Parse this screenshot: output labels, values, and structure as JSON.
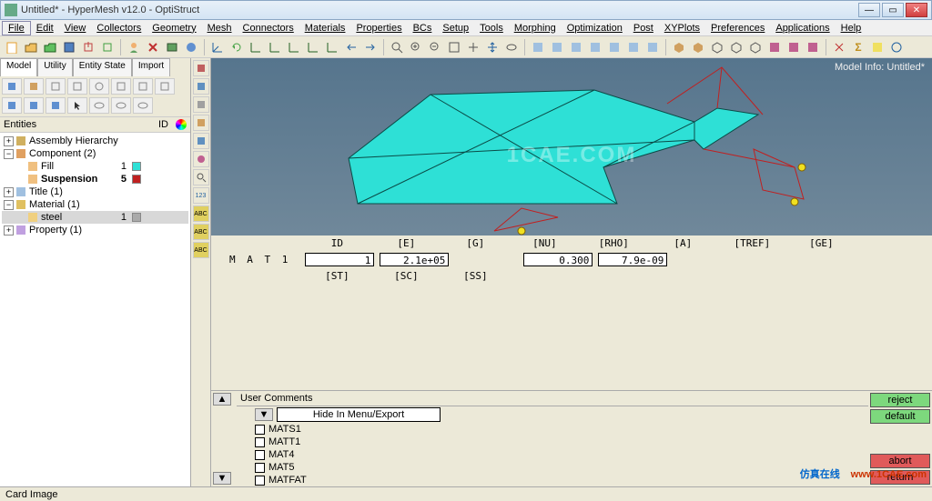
{
  "window": {
    "title": "Untitled* - HyperMesh v12.0 - OptiStruct"
  },
  "menu": [
    "File",
    "Edit",
    "View",
    "Collectors",
    "Geometry",
    "Mesh",
    "Connectors",
    "Materials",
    "Properties",
    "BCs",
    "Setup",
    "Tools",
    "Morphing",
    "Optimization",
    "Post",
    "XYPlots",
    "Preferences",
    "Applications",
    "Help"
  ],
  "tabs": [
    "Model",
    "Utility",
    "Entity State",
    "Import"
  ],
  "tree": {
    "headers": {
      "entities": "Entities",
      "id": "ID"
    },
    "assembly": "Assembly Hierarchy",
    "component": {
      "label": "Component (2)"
    },
    "fill": {
      "label": "Fill",
      "id": "1",
      "color": "#2ee0d6"
    },
    "suspension": {
      "label": "Suspension",
      "id": "5",
      "color": "#c02020"
    },
    "title": {
      "label": "Title (1)"
    },
    "material": {
      "label": "Material (1)"
    },
    "steel": {
      "label": "steel",
      "id": "1",
      "color": "#aaaaaa"
    },
    "property": {
      "label": "Property (1)"
    }
  },
  "viewport": {
    "model_info": "Model Info: Untitled*",
    "watermark": "1CAE.COM"
  },
  "mat": {
    "name": "M A T 1",
    "headers1": [
      "ID",
      "[E]",
      "[G]",
      "[NU]",
      "[RHO]",
      "[A]",
      "[TREF]",
      "[GE]"
    ],
    "values1": [
      "1",
      "2.1e+05",
      "",
      "0.300",
      "7.9e-09",
      "",
      "",
      ""
    ],
    "headers2": [
      "[ST]",
      "[SC]",
      "[SS]"
    ],
    "values2": [
      "",
      "",
      ""
    ]
  },
  "comments": {
    "header": "User Comments",
    "hide": "Hide In Menu/Export",
    "items": [
      "MATS1",
      "MATT1",
      "MAT4",
      "MAT5",
      "MATFAT"
    ]
  },
  "buttons": {
    "reject": "reject",
    "default": "default",
    "abort": "abort",
    "return": "return"
  },
  "status": "Card Image",
  "footer": {
    "cn": "仿真在线",
    "url": "www.1CAE.com"
  }
}
